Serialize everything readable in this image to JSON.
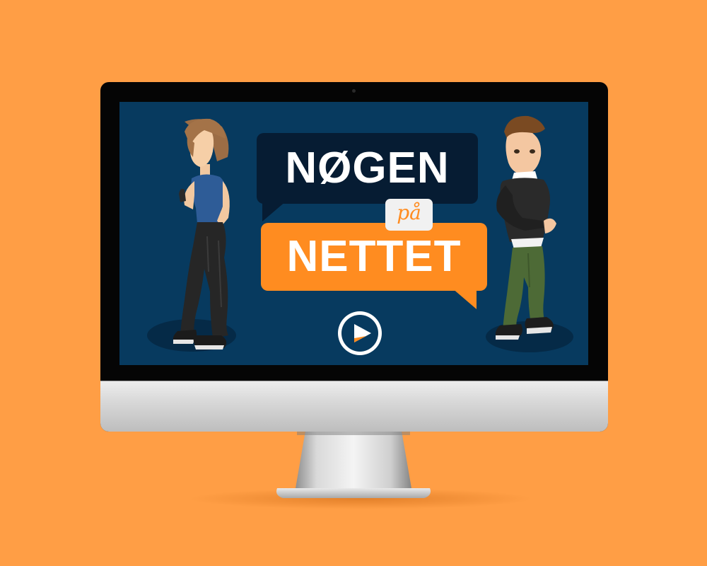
{
  "title": {
    "line1": "NØGEN",
    "connector": "på",
    "line2": "NETTET"
  },
  "play_button": {
    "icon": "play-icon"
  },
  "colors": {
    "background": "#FF9E45",
    "screen": "#073A5F",
    "bubble_dark": "#061C33",
    "bubble_orange": "#FF8C20",
    "pa_box": "#F1F1F1",
    "text_light": "#FFFFFF"
  }
}
